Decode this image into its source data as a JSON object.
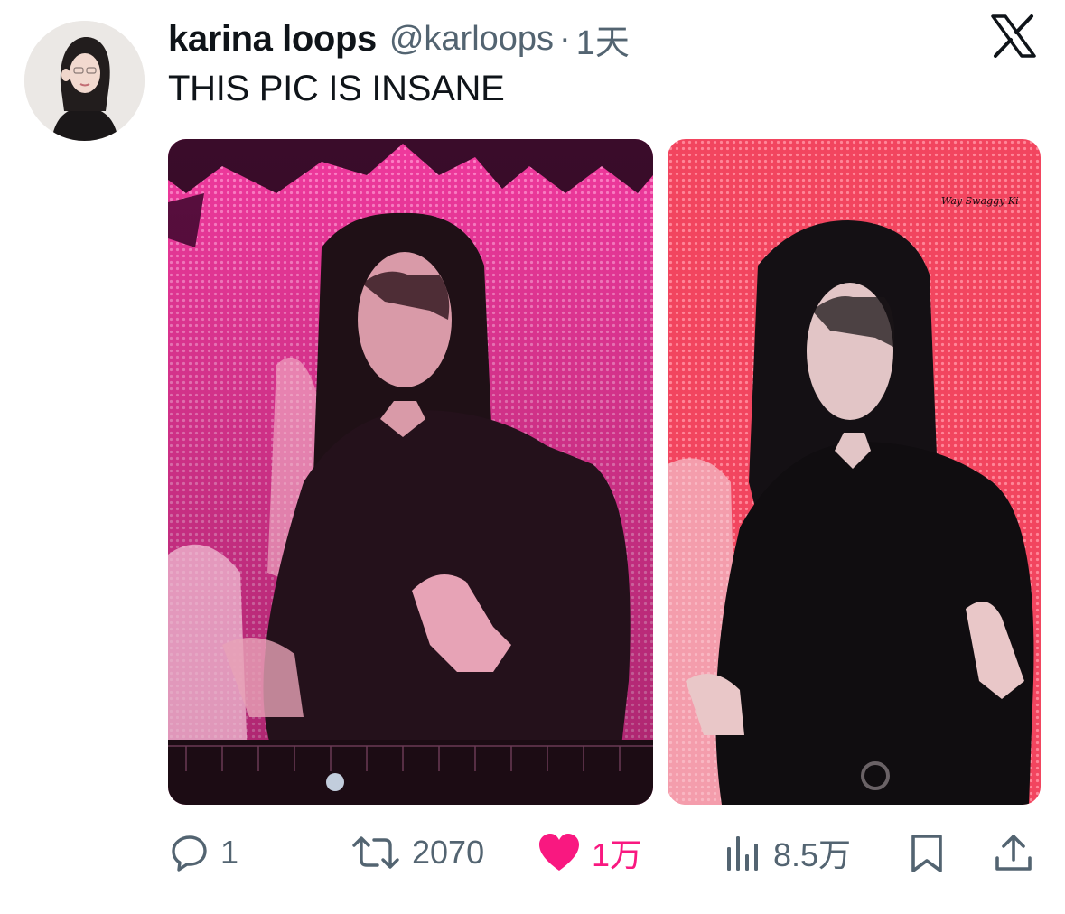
{
  "tweet": {
    "display_name": "karina loops",
    "handle": "@karloops",
    "separator": "·",
    "time": "1天",
    "text": "THIS PIC IS INSANE",
    "platform_icon": "x-logo-icon",
    "media": [
      {
        "alt": "photo-1",
        "watermark": ""
      },
      {
        "alt": "photo-2",
        "watermark": "Way Swaggy Ki"
      }
    ]
  },
  "actions": {
    "reply": {
      "icon": "reply-icon",
      "count": "1"
    },
    "retweet": {
      "icon": "retweet-icon",
      "count": "2070"
    },
    "like": {
      "icon": "heart-icon",
      "count": "1万",
      "active": true,
      "color": "#f91880"
    },
    "views": {
      "icon": "views-icon",
      "count": "8.5万"
    },
    "bookmark": {
      "icon": "bookmark-icon"
    },
    "share": {
      "icon": "share-icon"
    }
  },
  "colors": {
    "text_primary": "#0f1419",
    "text_secondary": "#536471",
    "like": "#f91880"
  }
}
